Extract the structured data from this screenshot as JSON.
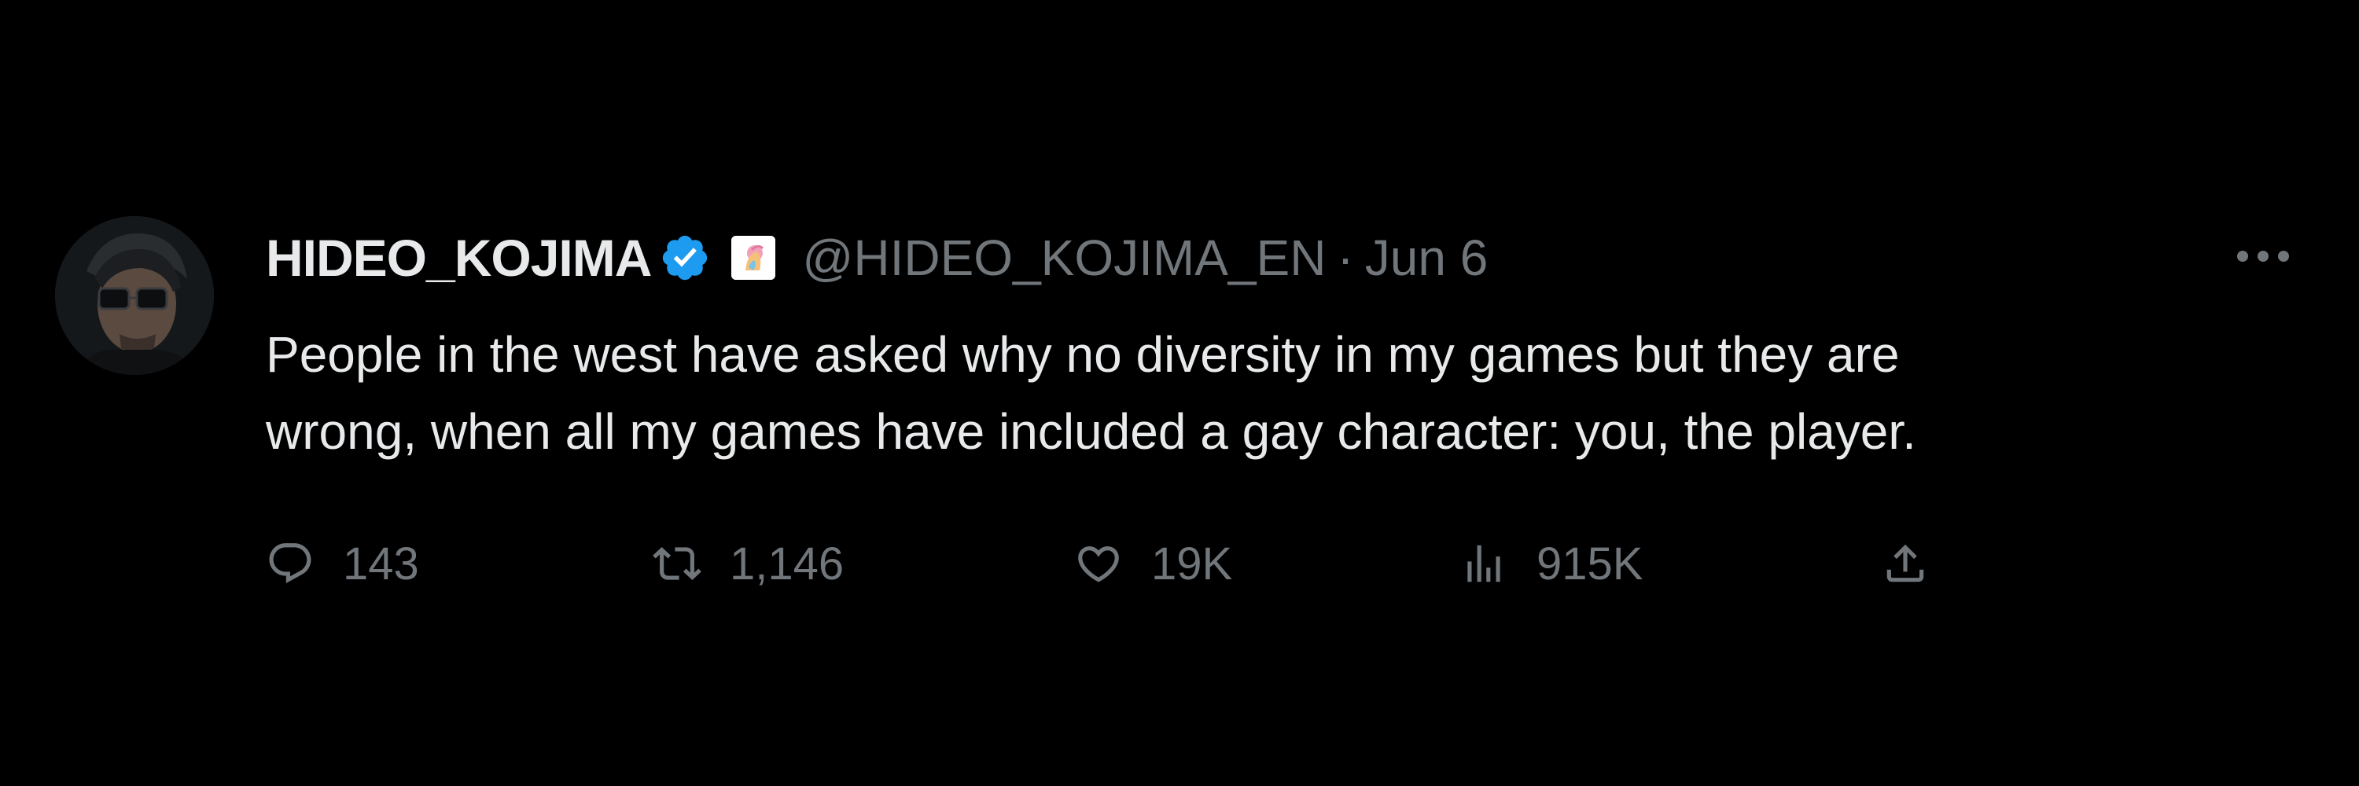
{
  "tweet": {
    "author": {
      "display_name": "HIDEO_KOJIMA",
      "handle": "@HIDEO_KOJIMA_EN",
      "verified": true
    },
    "separator": "·",
    "date": "Jun 6",
    "text_lines": [
      "People in the west have asked why no diversity in my games but they are",
      "wrong, when all my games have included a gay character: you, the player."
    ],
    "actions": {
      "reply": {
        "icon": "reply-icon",
        "count": "143"
      },
      "retweet": {
        "icon": "retweet-icon",
        "count": "1,146"
      },
      "like": {
        "icon": "heart-icon",
        "count": "19K"
      },
      "views": {
        "icon": "views-icon",
        "count": "915K"
      },
      "share": {
        "icon": "share-icon"
      }
    }
  },
  "colors": {
    "background": "#000000",
    "primary_text": "#e7e9ea",
    "secondary_text": "#71767b",
    "verified_badge": "#1d9bf0"
  }
}
